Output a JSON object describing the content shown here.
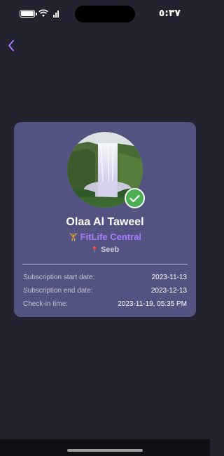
{
  "status_bar": {
    "time": "٥:٣٧",
    "icons": [
      "battery-icon",
      "wifi-icon",
      "signal-icon"
    ]
  },
  "navigation": {
    "back_icon": "chevron-left-icon",
    "accent_color": "#a77bff"
  },
  "profile_card": {
    "background_color": "#535382",
    "avatar_image": "waterfall landscape photo",
    "verified_badge_icon": "checkmark-icon",
    "verified_badge_color": "#4caf50",
    "name": "Olaa Al Taweel",
    "gym_icon": "dumbbell-icon",
    "gym_name": "FitLife Central",
    "location_icon": "map-pin-icon",
    "location": "Seeb",
    "details": [
      {
        "label": "Subscription start date:",
        "value": "2023-11-13"
      },
      {
        "label": "Subscription end date:",
        "value": "2023-12-13"
      },
      {
        "label": "Check-in time:",
        "value": "2023-11-19, 05:35 PM"
      }
    ]
  }
}
